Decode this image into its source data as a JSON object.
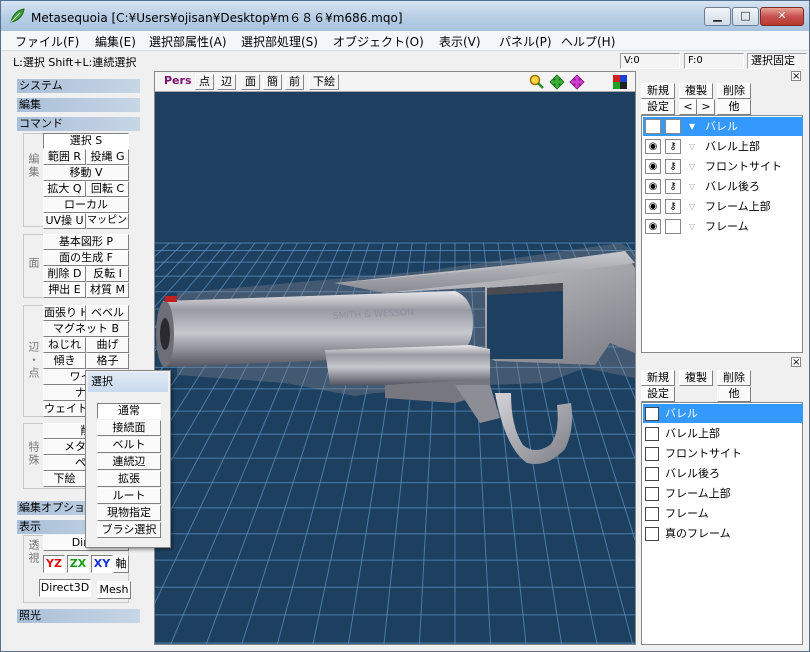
{
  "window": {
    "title": "Metasequoia [C:¥Users¥ojisan¥Desktop¥m６８６¥m686.mqo]",
    "min_label": "▁",
    "max_label": "□",
    "close_label": "✕"
  },
  "menu": [
    "ファイル(F)",
    "編集(E)",
    "選択部属性(A)",
    "選択部処理(S)",
    "オブジェクト(O)",
    "表示(V)",
    "パネル(P)",
    "ヘルプ(H)"
  ],
  "status": {
    "hint": "L:選択  Shift+L:連続選択",
    "v": "V:0",
    "f": "F:0",
    "lock": "選択固定"
  },
  "left": {
    "sections": {
      "system": "システム",
      "edit": "編集",
      "command": "コマンド",
      "edit_option": "編集オプション",
      "display": "表示",
      "lighting": "照光"
    },
    "groups": {
      "edit": "編集",
      "face": "面",
      "edge_point": "辺・点",
      "special": "特殊",
      "display_tag": "透視"
    },
    "edit_buttons": [
      "選択 S",
      "範囲 R",
      "投縄 G",
      "移動 V",
      "拡大 Q",
      "回転 C",
      "ローカル",
      "UV操 U",
      "マッピング"
    ],
    "face_buttons": [
      "基本図形 P",
      "面の生成 F",
      "削除 D",
      "反転 I",
      "押出 E",
      "材質 M"
    ],
    "edge_buttons": [
      "面張り H",
      "ベベル",
      "マグネット B",
      "ねじれ",
      "曲げ",
      "傾き",
      "格子",
      "ワイヤ",
      "ナイ",
      "ウェイト"
    ],
    "special_buttons": [
      "削",
      "メタボー",
      "ペイ",
      "下絵"
    ],
    "display": {
      "direct": "Direc",
      "yz": "YZ",
      "zx": "ZX",
      "xy": "XY",
      "axis": "軸",
      "direct3d": "Direct3D",
      "mesh": "Mesh"
    }
  },
  "popup": {
    "title": "選択",
    "items": [
      "通常",
      "接続面",
      "ベルト",
      "連続辺",
      "拡張",
      "ルート",
      "現物指定",
      "ブラシ選択"
    ]
  },
  "viewport": {
    "toolbar": [
      "Pers",
      "点",
      "辺",
      "面",
      "簡",
      "前",
      "下絵"
    ],
    "background": "#1e4060",
    "grid_color": "#5a8fc0",
    "engraving": "SMITH & WESSON"
  },
  "objects": {
    "buttons": [
      "新規",
      "複製",
      "削除",
      "設定",
      "<",
      ">",
      "他"
    ],
    "items": [
      {
        "name": "バレル",
        "active": true,
        "lock": true
      },
      {
        "name": "バレル上部",
        "active": false,
        "lock": true
      },
      {
        "name": "フロントサイト",
        "active": false,
        "lock": true
      },
      {
        "name": "バレル後ろ",
        "active": false,
        "lock": true
      },
      {
        "name": "フレーム上部",
        "active": false,
        "lock": true
      },
      {
        "name": "フレーム",
        "active": false,
        "lock": false
      }
    ]
  },
  "materials": {
    "buttons": [
      "新規",
      "複製",
      "削除",
      "設定",
      "他"
    ],
    "items": [
      {
        "name": "バレル",
        "active": true
      },
      {
        "name": "バレル上部",
        "active": false
      },
      {
        "name": "フロントサイト",
        "active": false
      },
      {
        "name": "バレル後ろ",
        "active": false
      },
      {
        "name": "フレーム上部",
        "active": false
      },
      {
        "name": "フレーム",
        "active": false
      },
      {
        "name": "真のフレーム",
        "active": false
      }
    ]
  },
  "colors": {
    "accent": "#3399ff",
    "section_header": "#a9bfd8",
    "yz": "#e01010",
    "zx": "#10a010",
    "xy": "#1030e0"
  }
}
